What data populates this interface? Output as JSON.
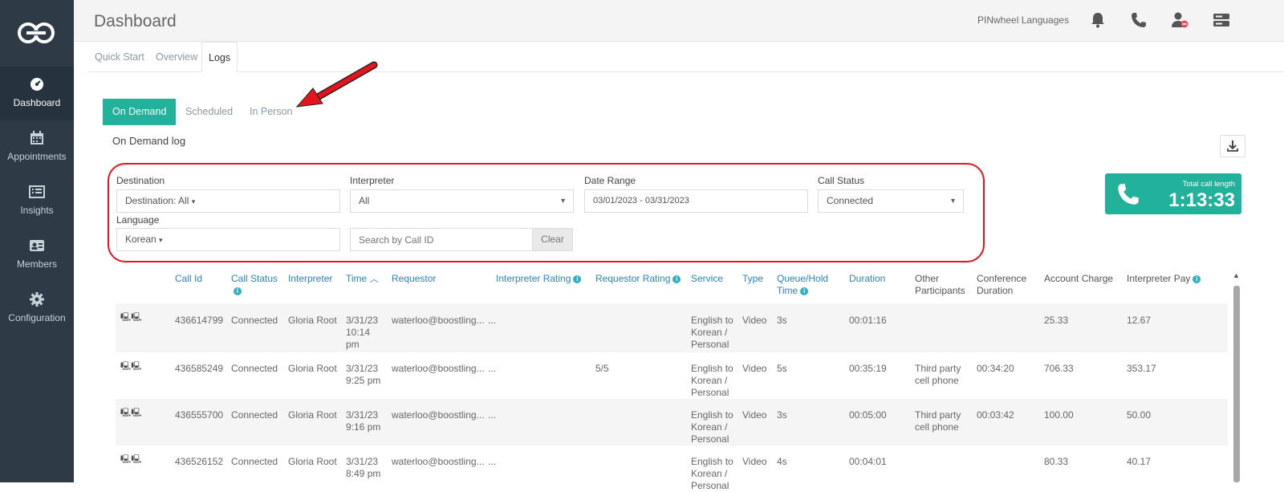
{
  "sidebar": {
    "logo_alt": "app-logo",
    "items": [
      {
        "label": "Dashboard",
        "icon": "speedometer-icon",
        "active": true
      },
      {
        "label": "Appointments",
        "icon": "calendar-icon",
        "active": false
      },
      {
        "label": "Insights",
        "icon": "list-icon",
        "active": false
      },
      {
        "label": "Members",
        "icon": "id-card-icon",
        "active": false
      },
      {
        "label": "Configuration",
        "icon": "gear-icon",
        "active": false
      }
    ]
  },
  "header": {
    "title": "Dashboard",
    "org_name": "PINwheel Languages",
    "icons": [
      "bell-icon",
      "phone-icon",
      "user-status-icon",
      "server-icon"
    ]
  },
  "tabs": [
    {
      "label": "Quick Start",
      "active": false
    },
    {
      "label": "Overview",
      "active": false
    },
    {
      "label": "Logs",
      "active": true
    }
  ],
  "subtabs": [
    {
      "label": "On Demand",
      "active": true
    },
    {
      "label": "Scheduled",
      "active": false
    },
    {
      "label": "In Person",
      "active": false
    }
  ],
  "section_title": "On Demand log",
  "filters": {
    "destination": {
      "label": "Destination",
      "value": "Destination: All"
    },
    "interpreter": {
      "label": "Interpreter",
      "value": "All"
    },
    "date_range": {
      "label": "Date Range",
      "value": "03/01/2023 - 03/31/2023"
    },
    "call_status": {
      "label": "Call Status",
      "value": "Connected"
    },
    "language": {
      "label": "Language",
      "value": "Korean"
    },
    "search": {
      "placeholder": "Search by Call ID",
      "clear_label": "Clear"
    }
  },
  "total_card": {
    "label": "Total call length",
    "value": "1:13:33"
  },
  "table": {
    "columns": [
      {
        "label": "Call Id"
      },
      {
        "label": "Call Status",
        "info": true
      },
      {
        "label": "Interpreter"
      },
      {
        "label": "Time",
        "sort": "up"
      },
      {
        "label": "Requestor"
      },
      {
        "label": "Interpreter Rating",
        "info": true
      },
      {
        "label": "Requestor Rating",
        "info": true
      },
      {
        "label": "Service"
      },
      {
        "label": "Type"
      },
      {
        "label": "Queue/Hold Time",
        "info": true
      },
      {
        "label": "Duration"
      },
      {
        "label": "Other Participants"
      },
      {
        "label": "Conference Duration"
      },
      {
        "label": "Account Charge"
      },
      {
        "label": "Interpreter Pay",
        "info": true
      }
    ],
    "rows": [
      {
        "call_id": "436614799",
        "status": "Connected",
        "interpreter": "Gloria Root",
        "time": "3/31/23 10:14 pm",
        "requestor": "waterloo@boostling...",
        "int_rating": "...",
        "req_rating": "",
        "service": "English to Korean / Personal",
        "type": "Video",
        "queue": "3s",
        "duration": "00:01:16",
        "other": "",
        "conf": "",
        "charge": "25.33",
        "pay": "12.67"
      },
      {
        "call_id": "436585249",
        "status": "Connected",
        "interpreter": "Gloria Root",
        "time": "3/31/23 9:25 pm",
        "requestor": "waterloo@boostling...",
        "int_rating": "...",
        "req_rating": "5/5",
        "service": "English to Korean / Personal",
        "type": "Video",
        "queue": "5s",
        "duration": "00:35:19",
        "other": "Third party cell phone",
        "conf": "00:34:20",
        "charge": "706.33",
        "pay": "353.17"
      },
      {
        "call_id": "436555700",
        "status": "Connected",
        "interpreter": "Gloria Root",
        "time": "3/31/23 9:16 pm",
        "requestor": "waterloo@boostling...",
        "int_rating": "...",
        "req_rating": "",
        "service": "English to Korean / Personal",
        "type": "Video",
        "queue": "3s",
        "duration": "00:05:00",
        "other": "Third party cell phone",
        "conf": "00:03:42",
        "charge": "100.00",
        "pay": "50.00"
      },
      {
        "call_id": "436526152",
        "status": "Connected",
        "interpreter": "Gloria Root",
        "time": "3/31/23 8:49 pm",
        "requestor": "waterloo@boostling...",
        "int_rating": "...",
        "req_rating": "",
        "service": "English to Korean / Personal",
        "type": "Video",
        "queue": "4s",
        "duration": "00:04:01",
        "other": "",
        "conf": "",
        "charge": "80.33",
        "pay": "40.17"
      }
    ]
  },
  "colors": {
    "sidebar": "#2e3a46",
    "accent": "#22b19b",
    "link": "#2b86c2",
    "annotation": "#e3141b"
  }
}
